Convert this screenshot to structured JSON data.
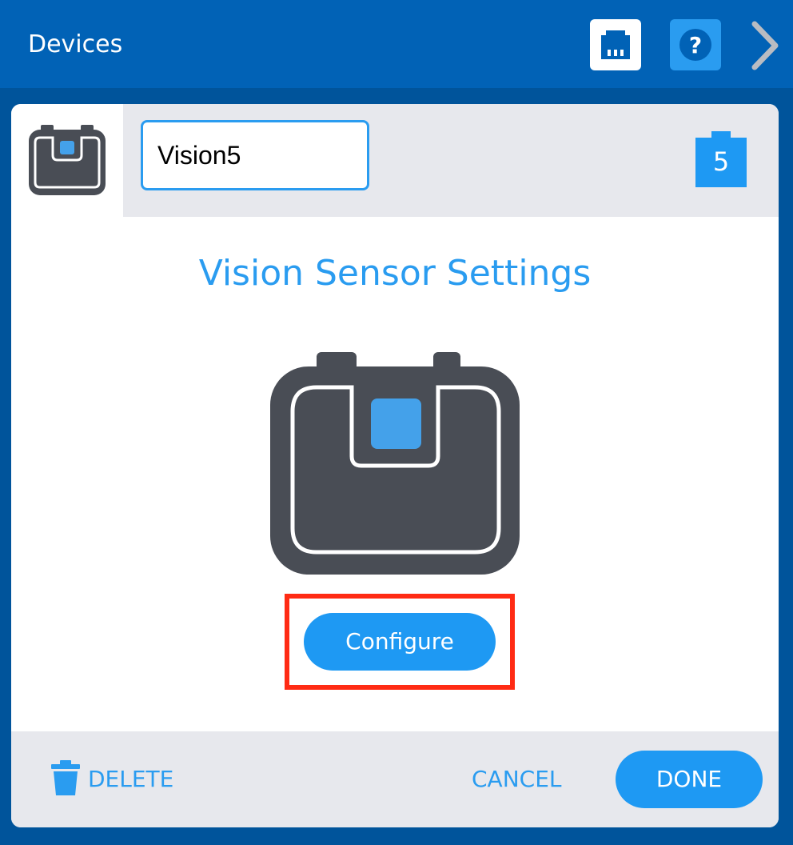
{
  "header": {
    "title": "Devices",
    "icons": {
      "port": "ethernet-port-icon",
      "help": "help-icon",
      "next": "chevron-right-icon"
    }
  },
  "device": {
    "name": "Vision5",
    "port": "5",
    "icon": "vision-sensor-icon"
  },
  "settings": {
    "title": "Vision Sensor Settings",
    "configure_label": "Configure"
  },
  "footer": {
    "delete_label": "DELETE",
    "cancel_label": "CANCEL",
    "done_label": "DONE"
  },
  "colors": {
    "background": "#00549b",
    "header": "#0162b6",
    "accent": "#2a9cf0",
    "button": "#1e99f3",
    "sensor_body": "#494d55",
    "highlight": "#ff2b14",
    "strip": "#e7e8ed"
  }
}
